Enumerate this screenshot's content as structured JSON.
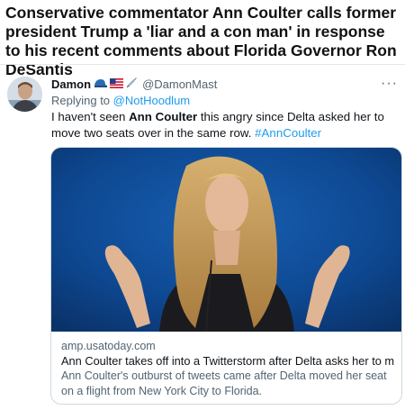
{
  "headline": "Conservative commentator Ann Coulter calls former president Trump a 'liar and a con man' in response to his recent comments about Florida Governor Ron DeSantis",
  "tweet": {
    "display_name": "Damon",
    "name_emojis": [
      "cap-emoji",
      "us-flag-emoji",
      "syringe-emoji"
    ],
    "handle": "@DamonMast",
    "more_label": "···",
    "replying_prefix": "Replying to",
    "replying_to": "@NotHoodlum",
    "text_before": "I haven't seen ",
    "text_bold": "Ann Coulter",
    "text_after": " this angry since Delta asked her to move two seats over in the same row. ",
    "hashtag": "#AnnCoulter"
  },
  "card": {
    "image": "woman-with-raised-hands-on-stage",
    "domain": "amp.usatoday.com",
    "title": "Ann Coulter takes off into a Twitterstorm after Delta asks her to move…",
    "description": "Ann Coulter's outburst of tweets came after Delta moved her seat on a flight from New York City to Florida."
  },
  "colors": {
    "link": "#1d9bf0",
    "secondary_text": "#536471",
    "card_border": "#cfd9de"
  }
}
